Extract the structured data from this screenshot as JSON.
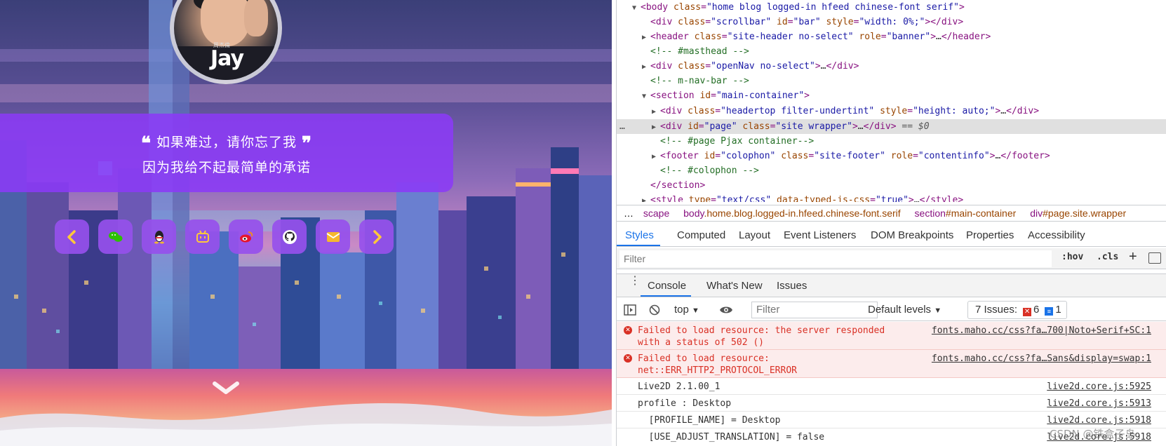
{
  "site": {
    "avatar_text": "Jay",
    "avatar_small_text": "周杰倫",
    "quote": {
      "line1": "如果难过，请你忘了我",
      "line2": "因为我给不起最简单的承诺",
      "open_mark": "❝",
      "close_mark": "❞"
    },
    "social_icons": [
      "chevron-left-icon",
      "wechat-icon",
      "qq-icon",
      "bilibili-icon",
      "weibo-icon",
      "github-icon",
      "email-icon",
      "chevron-right-icon"
    ],
    "colors": {
      "card": "#8b3af6",
      "button": "#9650eb",
      "chevron": "#ffc83a"
    }
  },
  "elements": {
    "lines": [
      {
        "tag": "body",
        "attrs": "class=\"home blog logged-in hfeed chinese-font serif\""
      },
      {
        "text": "<div class=\"scrollbar\" id=\"bar\" style=\"width: 0%;\"></div>"
      },
      {
        "text": "<header class=\"site-header no-select\" role=\"banner\">…</header>"
      },
      {
        "comment": "<!-- #masthead -->"
      },
      {
        "text": "<div class=\"openNav no-select\">…</div>"
      },
      {
        "comment": "<!-- m-nav-bar -->"
      },
      {
        "text": "<section id=\"main-container\">"
      },
      {
        "text": "<div class=\"headertop filter-undertint\" style=\"height: auto;\">…</div>"
      },
      {
        "text": "<div id=\"page\" class=\"site wrapper\">…</div>",
        "suffix": " == $0"
      },
      {
        "comment": "<!-- #page Pjax container-->"
      },
      {
        "text": "<footer id=\"colophon\" class=\"site-footer\" role=\"contentinfo\">…</footer>"
      },
      {
        "comment": "<!-- #colophon -->"
      },
      {
        "text": "</section>"
      },
      {
        "text": "<style type=\"text/css\" data-typed-js-css=\"true\">…</style>"
      }
    ],
    "dots": "…"
  },
  "breadcrumb": {
    "items": [
      {
        "tag": "scape",
        "rest": ""
      },
      {
        "tag": "body",
        "rest": ".home.blog.logged-in.hfeed.chinese-font.serif"
      },
      {
        "tag": "section",
        "rest": "#main-container"
      },
      {
        "tag": "div",
        "rest": "#page.site.wrapper"
      }
    ],
    "more": "…"
  },
  "subtabs": [
    "Styles",
    "Computed",
    "Layout",
    "Event Listeners",
    "DOM Breakpoints",
    "Properties",
    "Accessibility"
  ],
  "styles_filter": {
    "placeholder": "Filter",
    "hov": ":hov",
    "cls": ".cls",
    "plus": "+"
  },
  "drawer": {
    "tabs": [
      "Console",
      "What's New",
      "Issues"
    ]
  },
  "console_toolbar": {
    "context": "top",
    "filter_placeholder": "Filter",
    "levels": "Default levels",
    "issues_label": "7 Issues:",
    "errors_count": "6",
    "info_count": "1"
  },
  "console": [
    {
      "type": "error",
      "msg": "Failed to load resource: the server responded\nwith a status of 502 ()",
      "src": "fonts.maho.cc/css?fa…700|Noto+Serif+SC:1"
    },
    {
      "type": "error",
      "msg": "Failed to load resource:\nnet::ERR_HTTP2_PROTOCOL_ERROR",
      "src": "fonts.maho.cc/css?fa…Sans&display=swap:1"
    },
    {
      "type": "log",
      "msg": "Live2D 2.1.00_1",
      "src": "live2d.core.js:5925"
    },
    {
      "type": "log",
      "msg": "profile : Desktop",
      "src": "live2d.core.js:5913"
    },
    {
      "type": "log",
      "msg": "  [PROFILE_NAME] = Desktop",
      "src": "live2d.core.js:5918"
    },
    {
      "type": "log",
      "msg": "  [USE_ADJUST_TRANSLATION] = false",
      "src": "live2d.core.js:5918"
    }
  ],
  "watermark": "CSDN @铁盒子岛"
}
